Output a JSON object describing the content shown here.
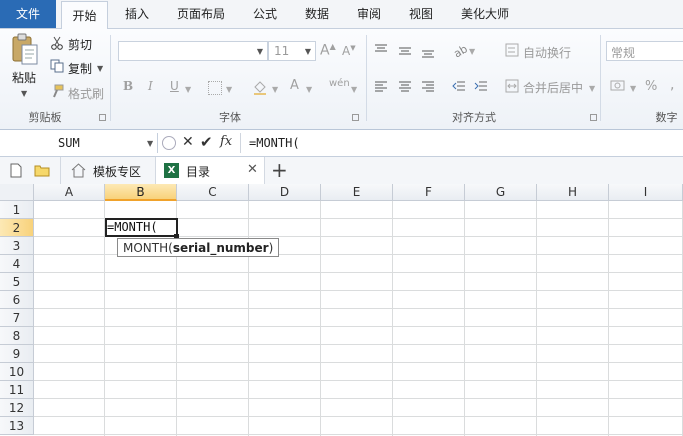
{
  "ribbon_tabs": {
    "file": "文件",
    "home": "开始",
    "insert": "插入",
    "page_layout": "页面布局",
    "formulas": "公式",
    "data": "数据",
    "review": "审阅",
    "view": "视图",
    "beautify": "美化大师"
  },
  "clipboard": {
    "paste": "粘贴",
    "cut": "剪切",
    "copy": "复制",
    "format_painter": "格式刷",
    "group_label": "剪贴板"
  },
  "font": {
    "font_name": "",
    "font_size": "11",
    "grow": "A",
    "shrink": "A",
    "bold": "B",
    "italic": "I",
    "underline": "U",
    "font_color": "A",
    "phonetic": "wén",
    "group_label": "字体"
  },
  "alignment": {
    "wrap_text": "自动换行",
    "merge_center": "合并后居中",
    "group_label": "对齐方式"
  },
  "number": {
    "format": "常规",
    "percent": "%",
    "group_label": "数字"
  },
  "formula_bar": {
    "name_box": "SUM",
    "fx": "fx",
    "formula": "=MONTH("
  },
  "doc_tabs": {
    "template_zone": "模板专区",
    "catalog": "目录",
    "new_tab": "+"
  },
  "columns": [
    "A",
    "B",
    "C",
    "D",
    "E",
    "F",
    "G",
    "H",
    "I"
  ],
  "rows": [
    "1",
    "2",
    "3",
    "4",
    "5",
    "6",
    "7",
    "8",
    "9",
    "10",
    "11",
    "12",
    "13"
  ],
  "active_cell": {
    "value": "=MONTH(",
    "tooltip_function": "MONTH(",
    "tooltip_arg": "serial_number",
    "tooltip_close": ")"
  },
  "colors": {
    "file_tab": "#2a6bb5",
    "selected_header": "#f8d27b",
    "excel_green": "#1f7244"
  }
}
